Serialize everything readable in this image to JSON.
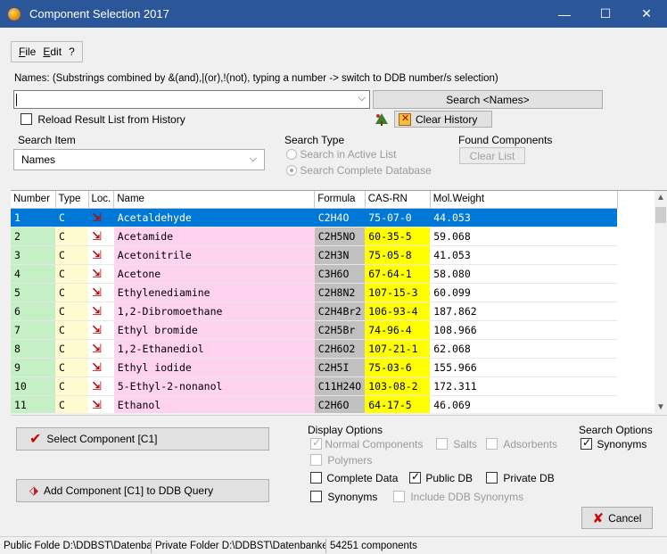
{
  "window": {
    "title": "Component Selection 2017",
    "controls": [
      "—",
      "☐",
      "✕"
    ]
  },
  "menu": [
    "File",
    "Edit",
    "?"
  ],
  "names_hint": "Names: (Substrings combined by &(and),|(or),!(not), typing a number -> switch to DDB number/s selection)",
  "search_names": {
    "value": "",
    "button": "Search <Names>"
  },
  "reload_history": {
    "label": "Reload Result List from History",
    "checked": false
  },
  "clear_history_button": "Clear History",
  "search_item": {
    "label": "Search Item",
    "value": "Names"
  },
  "search_type": {
    "label": "Search Type",
    "options": [
      {
        "label": "Search in Active List",
        "selected": false
      },
      {
        "label": "Search Complete Database",
        "selected": true
      }
    ]
  },
  "found_components": {
    "label": "Found Components",
    "clear_button": "Clear List"
  },
  "table": {
    "columns": [
      "Number",
      "Type",
      "Loc.",
      "Name",
      "Formula",
      "CAS-RN",
      "Mol.Weight"
    ],
    "rows": [
      {
        "number": "1",
        "type": "C",
        "name": "Acetaldehyde",
        "formula": "C2H4O",
        "cas": "75-07-0",
        "mw": "44.053",
        "selected": true
      },
      {
        "number": "2",
        "type": "C",
        "name": "Acetamide",
        "formula": "C2H5NO",
        "cas": "60-35-5",
        "mw": "59.068"
      },
      {
        "number": "3",
        "type": "C",
        "name": "Acetonitrile",
        "formula": "C2H3N",
        "cas": "75-05-8",
        "mw": "41.053"
      },
      {
        "number": "4",
        "type": "C",
        "name": "Acetone",
        "formula": "C3H6O",
        "cas": "67-64-1",
        "mw": "58.080"
      },
      {
        "number": "5",
        "type": "C",
        "name": "Ethylenediamine",
        "formula": "C2H8N2",
        "cas": "107-15-3",
        "mw": "60.099"
      },
      {
        "number": "6",
        "type": "C",
        "name": "1,2-Dibromoethane",
        "formula": "C2H4Br2",
        "cas": "106-93-4",
        "mw": "187.862"
      },
      {
        "number": "7",
        "type": "C",
        "name": "Ethyl bromide",
        "formula": "C2H5Br",
        "cas": "74-96-4",
        "mw": "108.966"
      },
      {
        "number": "8",
        "type": "C",
        "name": "1,2-Ethanediol",
        "formula": "C2H6O2",
        "cas": "107-21-1",
        "mw": "62.068"
      },
      {
        "number": "9",
        "type": "C",
        "name": "Ethyl iodide",
        "formula": "C2H5I",
        "cas": "75-03-6",
        "mw": "155.966"
      },
      {
        "number": "10",
        "type": "C",
        "name": "5-Ethyl-2-nonanol",
        "formula": "C11H24O",
        "cas": "103-08-2",
        "mw": "172.311"
      },
      {
        "number": "11",
        "type": "C",
        "name": "Ethanol",
        "formula": "C2H6O",
        "cas": "64-17-5",
        "mw": "46.069"
      }
    ]
  },
  "select_component_button": "Select Component [C1]",
  "add_component_button": "Add Component [C1] to DDB Query",
  "display_options": {
    "label": "Display Options",
    "normal_components": {
      "label": "Normal Components",
      "checked": true,
      "enabled": false
    },
    "salts": {
      "label": "Salts",
      "checked": false,
      "enabled": false
    },
    "adsorbents": {
      "label": "Adsorbents",
      "checked": false,
      "enabled": false
    },
    "polymers": {
      "label": "Polymers",
      "checked": false,
      "enabled": false
    },
    "complete_data": {
      "label": "Complete Data",
      "checked": false,
      "enabled": true
    },
    "public_db": {
      "label": "Public DB",
      "checked": true,
      "enabled": true
    },
    "private_db": {
      "label": "Private DB",
      "checked": false,
      "enabled": true
    },
    "synonyms": {
      "label": "Synonyms",
      "checked": false,
      "enabled": true
    },
    "include_ddb_synonyms": {
      "label": "Include DDB Synonyms",
      "checked": false,
      "enabled": false
    }
  },
  "search_options": {
    "label": "Search Options",
    "synonyms": {
      "label": "Synonyms",
      "checked": true
    }
  },
  "cancel_button": "Cancel",
  "status": {
    "public_folder": "Public Folde D:\\DDBST\\Datenbanken\\DI",
    "private_folder": "Private Folder D:\\DDBST\\Datenbanken\\DDBP",
    "count": "54251 components"
  },
  "colors": {
    "titlebar": "#2b579a",
    "number_col": "#c5f0c5",
    "type_col": "#fffbd0",
    "name_col": "#ffd2f0",
    "formula_col": "#c0c0c0",
    "cas_col": "#ffff00",
    "selection": "#0078d7"
  }
}
